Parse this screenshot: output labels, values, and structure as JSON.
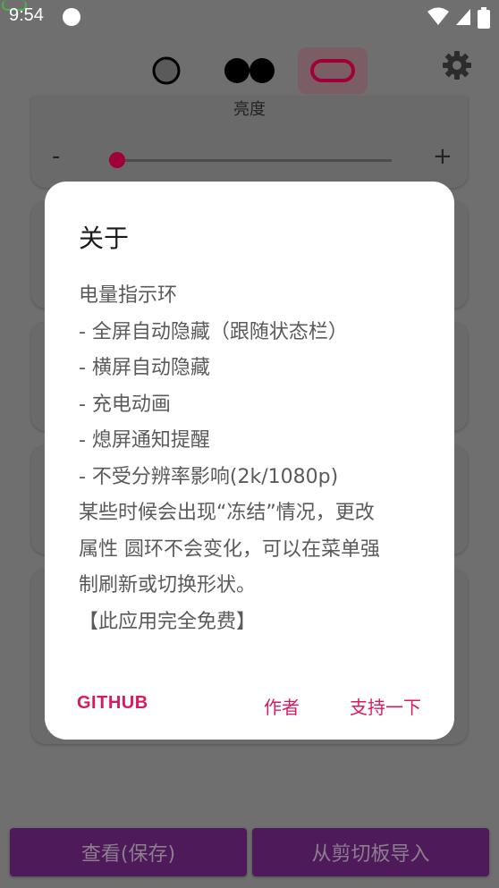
{
  "status_bar": {
    "time": "9:54",
    "icons": [
      "notification-dot-icon",
      "wifi-icon",
      "signal-icon",
      "battery-icon"
    ]
  },
  "toolbar": {
    "shapes": [
      "circle-shape-icon",
      "two-circles-shape-icon",
      "pill-shape-icon"
    ],
    "active_shape": "pill-shape-icon",
    "settings_icon": "gear-icon"
  },
  "brightness": {
    "label": "亮度",
    "minus": "-",
    "plus": "+",
    "value": 0.03
  },
  "dialog": {
    "title": "关于",
    "lines": [
      "电量指示环",
      "- 全屏自动隐藏（跟随状态栏）",
      "- 横屏自动隐藏",
      "- 充电动画",
      "- 熄屏通知提醒",
      "- 不受分辨率影响(2k/1080p)",
      "某些时候会出现“冻结”情况，更改",
      "属性 圆环不会变化，可以在菜单强",
      "制刷新或切换形状。",
      "【此应用完全免费】"
    ],
    "actions": {
      "github": "GITHUB",
      "author": "作者",
      "support": "支持一下"
    }
  },
  "bottom_buttons": {
    "view_save": "查看(保存)",
    "import_clipboard": "从剪切板导入"
  },
  "colors": {
    "accent": "#d81b60",
    "scrim_bg": "#6f6f6f",
    "button_bg": "#4e1a5a"
  }
}
